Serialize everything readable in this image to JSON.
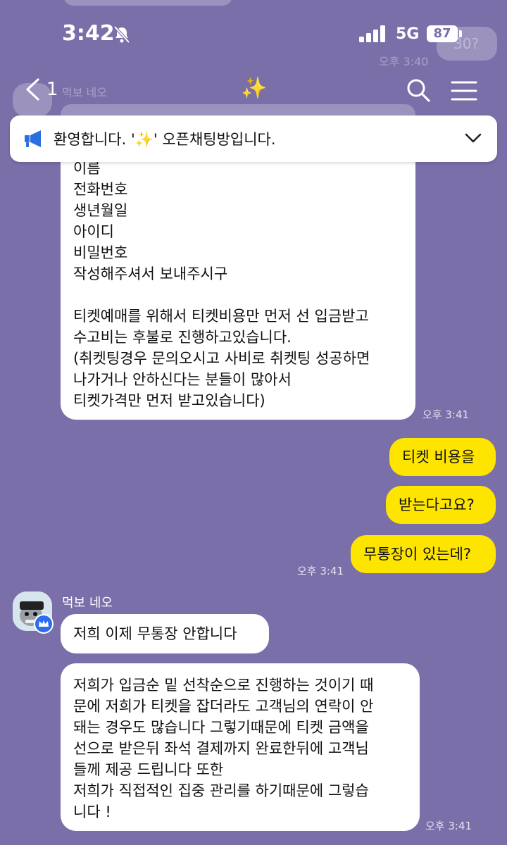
{
  "status_bar": {
    "time": "3:42",
    "network": "5G",
    "battery": "87"
  },
  "background_ghosts": {
    "bubble_text": "30?",
    "time_text": "오후 3:40",
    "sender_text": "먹보 네오"
  },
  "nav": {
    "unread_count": "1",
    "title": "✨"
  },
  "notice": {
    "text": "환영합니다. '✨' 오픈채팅방입니다."
  },
  "messages": {
    "first_block": {
      "lines": [
        "이름",
        "전화번호",
        "생년월일",
        "아이디",
        "비밀번호",
        "작성해주셔서 보내주시구",
        "",
        "티켓예매를 위해서 티켓비용만 먼저 선 입금받고",
        "수고비는 후불로 진행하고있습니다.",
        "(취켓팅경우 문의오시고 사비로 취켓팅 성공하면",
        "나가거나 안하신다는 분들이 많아서",
        "티켓가격만 먼저 받고있습니다)"
      ],
      "time": "오후 3:41"
    },
    "my_messages": [
      "티켓 비용을",
      "받는다고요?",
      "무통장이 있는데?"
    ],
    "my_time": "오후 3:41",
    "sender_name": "먹보 네오",
    "reply_short": "저희 이제 무통장 안합니다",
    "reply_long": {
      "lines": [
        "저희가 입금순 밑 선착순으로 진행하는 것이기 때",
        "문에 저희가 티켓을 잡더라도 고객님의 연락이 안",
        "돼는 경우도 많습니다 그렇기때문에 티켓 금액을",
        "선으로 받은뒤 좌석 결제까지 완료한뒤에 고객님",
        "들께 제공 드립니다 또한",
        "저희가 직접적인 집중 관리를 하기때문에 그렇습",
        "니다 !"
      ],
      "time": "오후 3:41"
    }
  },
  "colors": {
    "background": "#7a6fa8",
    "mine": "#fee500",
    "theirs": "#ffffff"
  }
}
